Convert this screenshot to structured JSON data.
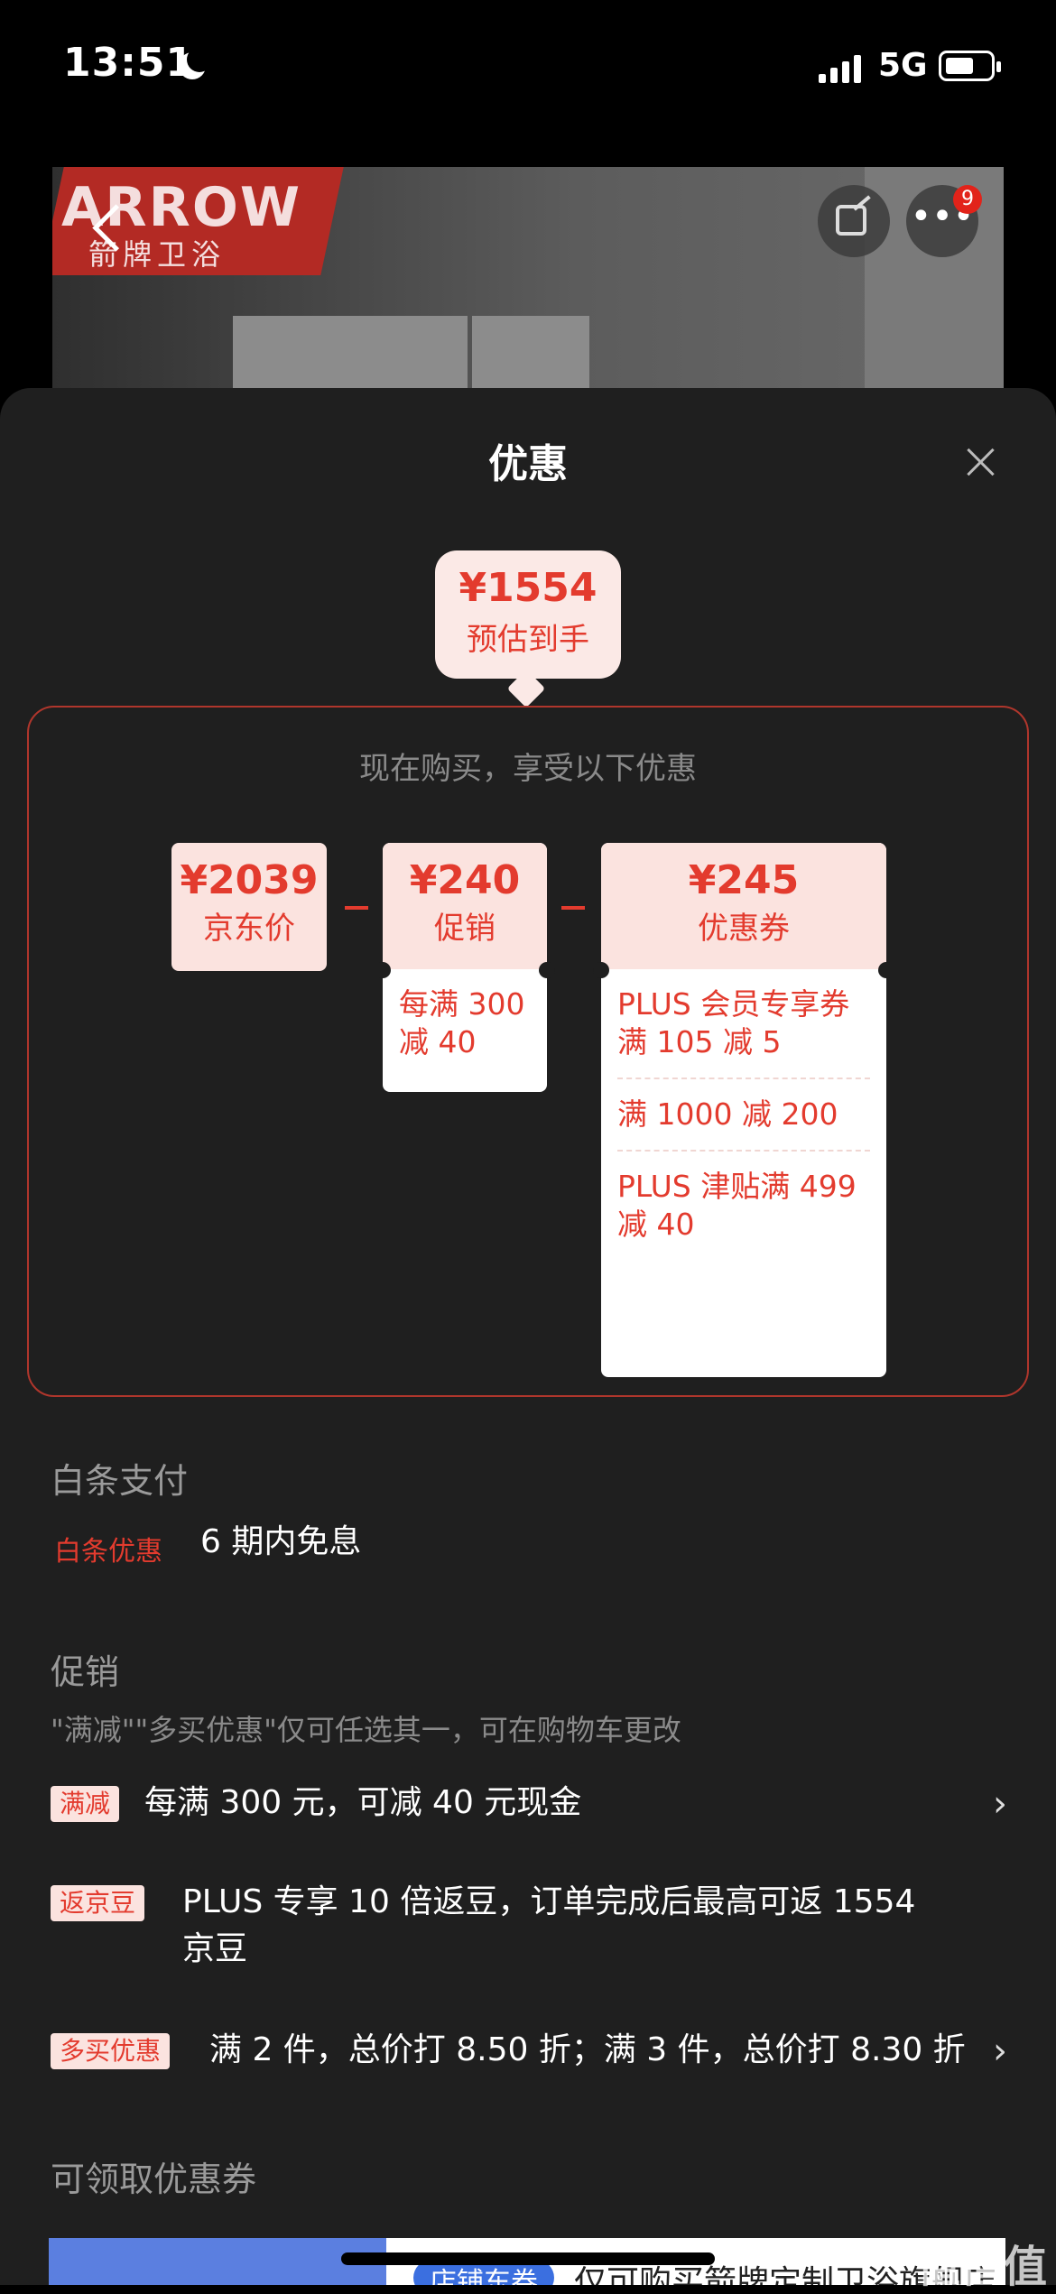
{
  "status_bar": {
    "time": "13:51",
    "network": "5G"
  },
  "hero": {
    "brand_text": "ARROW",
    "brand_sub": "箭牌卫浴",
    "badge_count": "9"
  },
  "sheet": {
    "title": "优惠"
  },
  "estimate": {
    "price": "¥1554",
    "label": "预估到手"
  },
  "breakdown": {
    "caption": "现在购买，享受以下优惠",
    "jd_price": {
      "amount": "¥2039",
      "label": "京东价"
    },
    "promo": {
      "amount": "¥240",
      "label": "促销",
      "details": [
        "每满 300 减 40"
      ]
    },
    "coupon": {
      "amount": "¥245",
      "label": "优惠券",
      "details": [
        "PLUS 会员专享券 满 105 减 5",
        "满 1000 减 200",
        "PLUS 津贴满 499 减 40"
      ]
    }
  },
  "baitiao": {
    "title": "白条支付",
    "tag": "白条优惠",
    "text": "6 期内免息"
  },
  "promotions": {
    "title": "促销",
    "note": "\"满减\"\"多买优惠\"仅可任选其一，可在购物车更改",
    "items": [
      {
        "tag": "满减",
        "text": "每满 300 元，可减 40 元现金",
        "chevron": "›"
      },
      {
        "tag": "返京豆",
        "text_line1": "PLUS 专享 10 倍返豆，订单完成后最高可返 1554",
        "text_line2": "京豆"
      },
      {
        "tag": "多买优惠",
        "text": "满 2 件，总价打 8.50 折；满 3 件，总价打 8.30 折",
        "chevron": "›"
      }
    ]
  },
  "coupons": {
    "title": "可领取优惠券",
    "preview_tag": "店铺东券",
    "preview_text": "仅可购买箭牌定制卫浴旗舰店"
  },
  "watermark": "值值值"
}
